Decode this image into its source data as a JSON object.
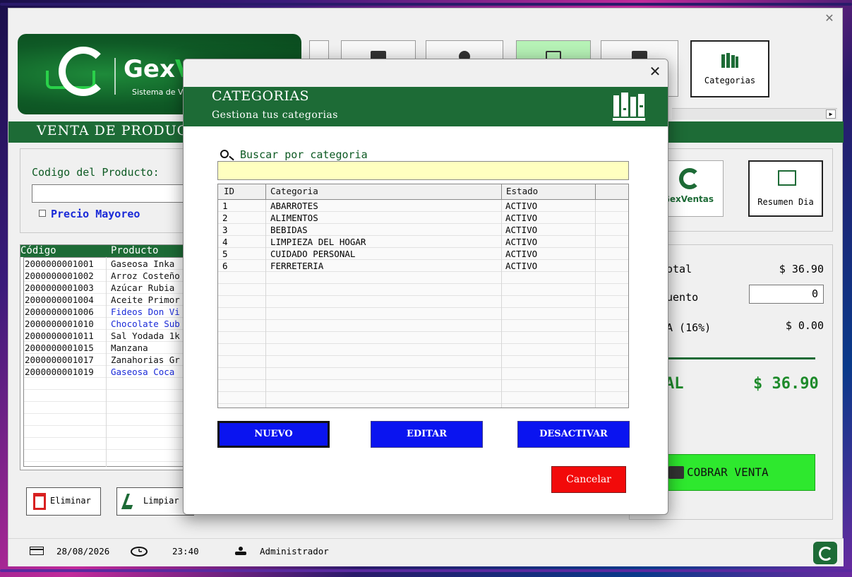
{
  "app": {
    "logo_text_gex": "Gex",
    "logo_text_v": "Ve",
    "logo_subtitle": "Sistema de Venta",
    "section_title": "VENTA DE PRODUC",
    "colors": {
      "brand_green": "#1d6b36",
      "accent_green": "#2ad14a",
      "blue_button": "#0a14f0",
      "red_button": "#f20a0a",
      "search_bg": "#ffffc0"
    }
  },
  "toolbar": {
    "categories_label": "Categorias"
  },
  "sale_form": {
    "code_label": "Codigo del Producto:",
    "code_value": "",
    "wholesale_label": "Precio Mayoreo"
  },
  "products": {
    "headers": [
      "Código",
      "Producto"
    ],
    "rows": [
      {
        "code": "2000000001001",
        "name": "Gaseosa Inka",
        "color": "#111111"
      },
      {
        "code": "2000000001002",
        "name": "Arroz Costeño",
        "color": "#111111"
      },
      {
        "code": "2000000001003",
        "name": "Azúcar Rubia",
        "color": "#111111"
      },
      {
        "code": "2000000001004",
        "name": "Aceite Primor",
        "color": "#111111"
      },
      {
        "code": "2000000001006",
        "name": "Fideos Don Vi",
        "color": "#1a2ad8"
      },
      {
        "code": "2000000001010",
        "name": "Chocolate Sub",
        "color": "#1a2ad8"
      },
      {
        "code": "2000000001011",
        "name": "Sal Yodada 1k",
        "color": "#111111"
      },
      {
        "code": "2000000001015",
        "name": "Manzana",
        "color": "#111111"
      },
      {
        "code": "2000000001017",
        "name": "Zanahorias Gr",
        "color": "#111111"
      },
      {
        "code": "2000000001019",
        "name": "Gaseosa Coca",
        "color": "#1a2ad8"
      }
    ],
    "delete_label": "Eliminar",
    "clear_label": "Limpiar"
  },
  "right_tiles": {
    "gex_label": "GexVentas",
    "summary_label": "Resumen Dia"
  },
  "totals": {
    "subtotal_label": "otal",
    "subtotal_value": "$ 36.90",
    "discount_label": "uento",
    "discount_value": "0",
    "tax_label": "A (16%)",
    "tax_value": "$ 0.00",
    "total_label": "AL",
    "total_value": "$ 36.90",
    "charge_label": "COBRAR VENTA"
  },
  "status": {
    "date": "28/08/2026",
    "time": "23:40",
    "user": "Administrador"
  },
  "modal": {
    "title": "CATEGORIAS",
    "subtitle": "Gestiona tus categorias",
    "search_label": "Buscar por categoria",
    "search_value": "",
    "columns": [
      "ID",
      "Categoria",
      "Estado"
    ],
    "rows": [
      {
        "id": "1",
        "name": "ABARROTES",
        "status": "ACTIVO"
      },
      {
        "id": "2",
        "name": "ALIMENTOS",
        "status": "ACTIVO"
      },
      {
        "id": "3",
        "name": "BEBIDAS",
        "status": "ACTIVO"
      },
      {
        "id": "4",
        "name": "LIMPIEZA DEL HOGAR",
        "status": "ACTIVO"
      },
      {
        "id": "5",
        "name": "CUIDADO PERSONAL",
        "status": "ACTIVO"
      },
      {
        "id": "6",
        "name": "FERRETERIA",
        "status": "ACTIVO"
      }
    ],
    "buttons": {
      "new": "NUEVO",
      "edit": "EDITAR",
      "deactivate": "DESACTIVAR",
      "cancel": "Cancelar"
    }
  }
}
